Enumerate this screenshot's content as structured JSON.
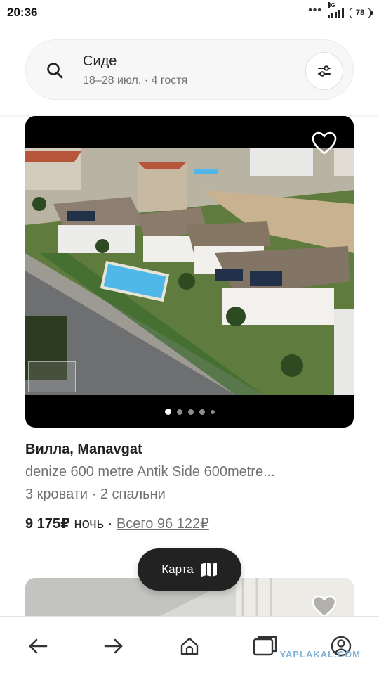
{
  "status_bar": {
    "time": "20:36",
    "more": "•••",
    "network": "4G",
    "battery": "78"
  },
  "search": {
    "title": "Сиде",
    "subtitle": "18–28 июл. · 4 гостя"
  },
  "listing": {
    "title": "Вилла, Manavgat",
    "description": "denize 600 metre Antik Side 600metre...",
    "beds": "3 кровати · 2 спальни",
    "price": "9 175₽",
    "price_unit": "ночь",
    "price_separator": "·",
    "total": "Всего 96 122₽",
    "carousel": {
      "count": 5,
      "active_index": 0
    }
  },
  "map_button": {
    "label": "Карта",
    "icon": "map-icon"
  },
  "bottom_nav": {
    "icons": [
      "back-arrow-icon",
      "forward-arrow-icon",
      "home-icon",
      "tabs-icon",
      "profile-icon"
    ]
  },
  "watermark": "YAPLAKAL.COM",
  "colors": {
    "text_primary": "#222222",
    "text_secondary": "#717171",
    "map_button_bg": "#222222",
    "pool": "#4fb8e8"
  }
}
